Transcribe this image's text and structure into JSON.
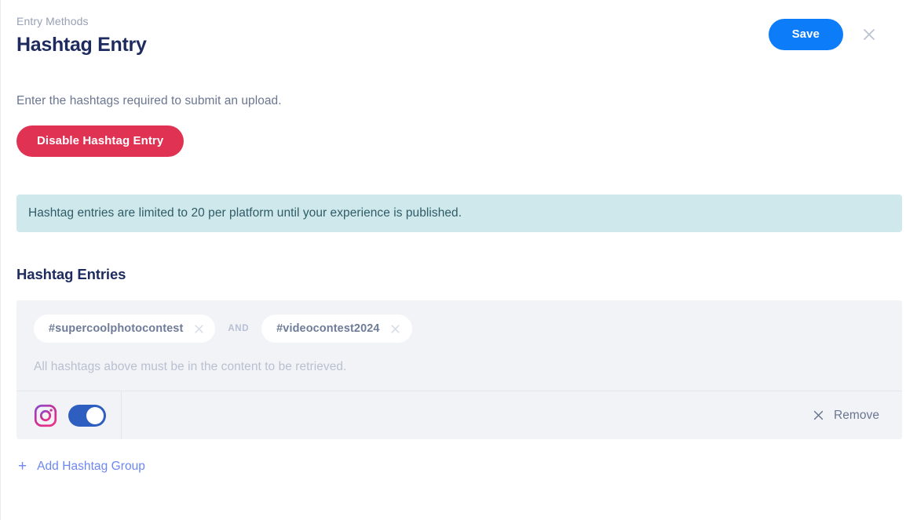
{
  "header": {
    "breadcrumb": "Entry Methods",
    "title": "Hashtag Entry",
    "save_label": "Save",
    "close_icon": "close-icon"
  },
  "main": {
    "description": "Enter the hashtags required to submit an upload.",
    "disable_label": "Disable Hashtag Entry",
    "info_banner": "Hashtag entries are limited to 20 per platform until your experience is published.",
    "section_heading": "Hashtag Entries"
  },
  "hashtag_group": {
    "chips": [
      {
        "label": "#supercoolphotocontest",
        "remove_icon": "close-icon"
      },
      {
        "label": "#videocontest2024",
        "remove_icon": "close-icon"
      }
    ],
    "separator": "AND",
    "helper_text": "All hashtags above must be in the content to be retrieved.",
    "platform": {
      "icon": "instagram-icon",
      "toggle_state": "on",
      "remove_icon": "close-icon",
      "remove_label": "Remove"
    }
  },
  "footer": {
    "add_plus": "+",
    "add_label": "Add Hashtag Group"
  },
  "colors": {
    "save_blue": "#0d7cf8",
    "disable_red": "#e03354",
    "banner_bg": "#cfe8ec",
    "card_bg": "#f1f3f7",
    "toggle_on": "#2e5fc0",
    "link_blue": "#6e87f0",
    "title_navy": "#1e2b5e"
  }
}
